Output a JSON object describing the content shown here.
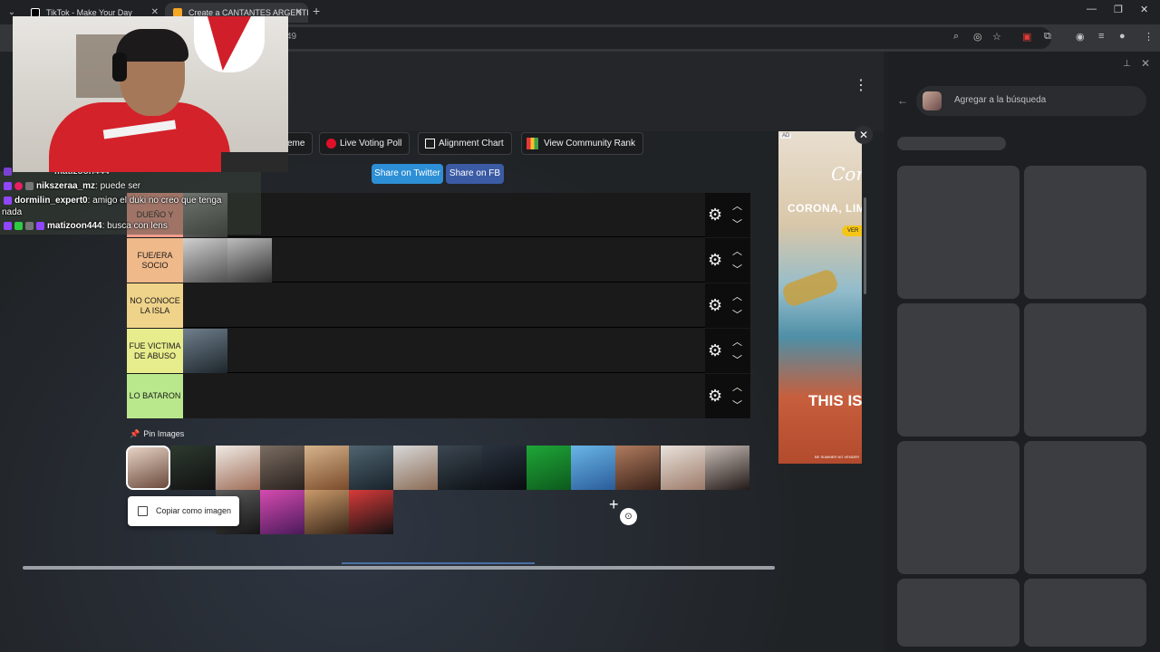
{
  "browser": {
    "tabs": [
      {
        "title": "TikTok - Make Your Day",
        "active": false
      },
      {
        "title": "Create a CANTANTES ARGENTI",
        "active": true
      }
    ],
    "address_fragment": "49"
  },
  "page": {
    "buttons": {
      "theme_partial": "eme",
      "live_voting": "Live Voting Poll",
      "alignment": "Alignment Chart",
      "community": "View Community Rank",
      "share_twitter": "Share on Twitter",
      "share_fb": "Share on FB"
    },
    "tiers": [
      {
        "label": "DUEÑO Y",
        "color": "#f09a8a",
        "items": 1
      },
      {
        "label": "FUE/ERA SOCIO",
        "color": "#efb98a",
        "items": 2
      },
      {
        "label": "NO CONOCE LA ISLA",
        "color": "#f0d38a",
        "items": 0
      },
      {
        "label": "FUE VICTIMA DE ABUSO",
        "color": "#e7ec8c",
        "items": 1
      },
      {
        "label": "LO BATARON",
        "color": "#b9e88c",
        "items": 0
      }
    ],
    "pin_label": "Pin Images",
    "context_menu": {
      "copy_as_image": "Copiar como imagen"
    },
    "ad": {
      "badge": "AD",
      "logo": "Coro",
      "tagline": "CORONA, LIM",
      "pill": "VER",
      "headline": "THIS IS",
      "fine": "BE SUMMER NO VENDER"
    }
  },
  "side_panel": {
    "search_placeholder": "Agregar a la búsqueda"
  },
  "chat": [
    {
      "user": "matizoon444",
      "message": "",
      "partial": true
    },
    {
      "user": "nikszeraa_mz",
      "message": "puede ser"
    },
    {
      "user": "dormilin_expert0",
      "message": "amigo el duki no creo que tenga"
    },
    {
      "user": "",
      "message": "nada"
    },
    {
      "user": "matizoon444",
      "message": "busca con lens"
    }
  ]
}
